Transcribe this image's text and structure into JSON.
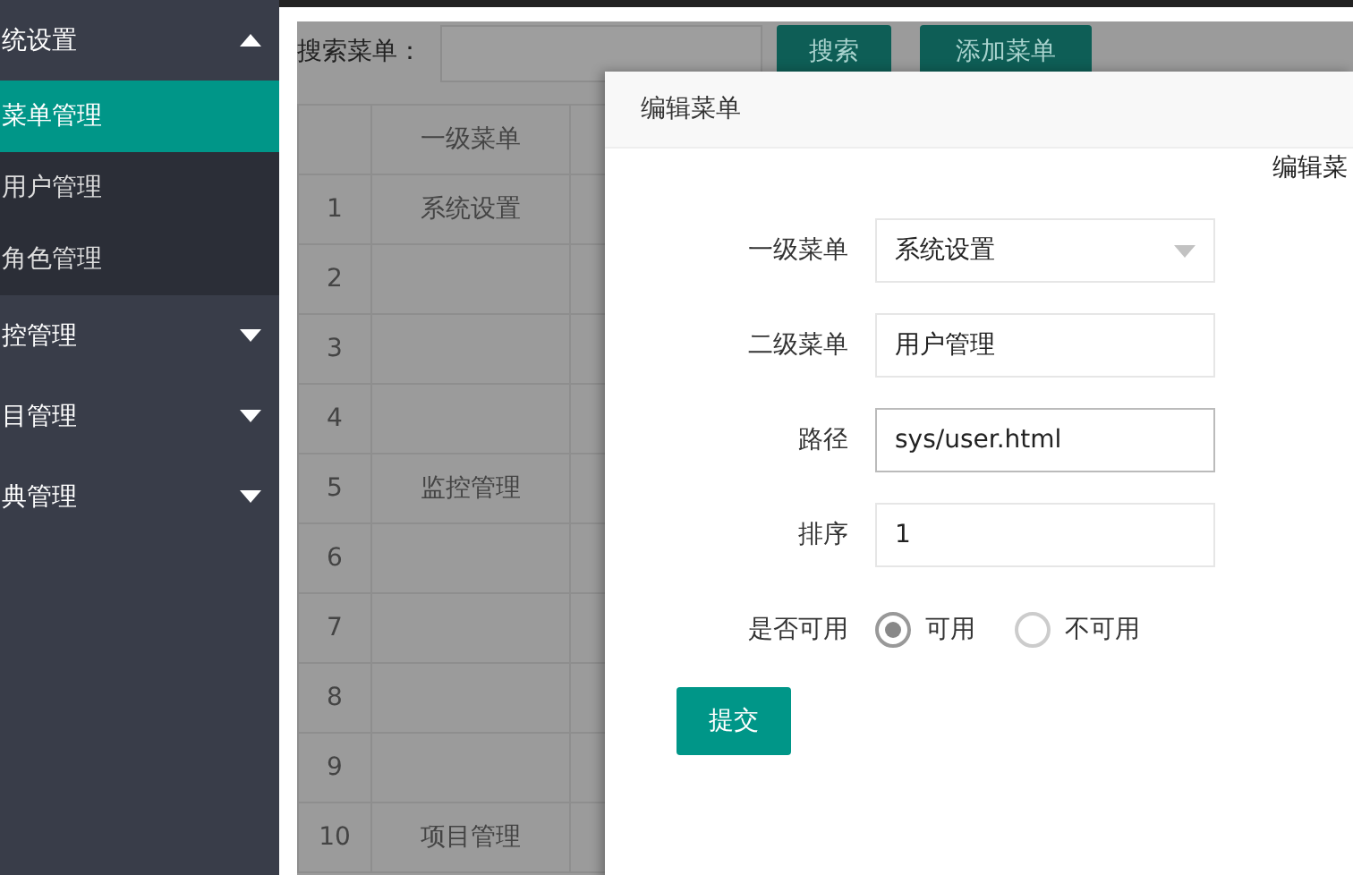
{
  "sidebar": {
    "groups": [
      {
        "label": "统设置",
        "expanded": true,
        "children": [
          {
            "label": "菜单管理",
            "selected": true
          },
          {
            "label": "用户管理",
            "selected": false
          },
          {
            "label": "角色管理",
            "selected": false
          }
        ]
      },
      {
        "label": "控管理",
        "expanded": false
      },
      {
        "label": "目管理",
        "expanded": false
      },
      {
        "label": "典管理",
        "expanded": false
      }
    ]
  },
  "toolbar": {
    "search_label": "搜索菜单：",
    "buttons": [
      "搜索",
      "添加菜单"
    ]
  },
  "table": {
    "columns": [
      "",
      "一级菜单"
    ],
    "rows": [
      [
        "1",
        "系统设置"
      ],
      [
        "2",
        ""
      ],
      [
        "3",
        ""
      ],
      [
        "4",
        ""
      ],
      [
        "5",
        "监控管理"
      ],
      [
        "6",
        ""
      ],
      [
        "7",
        ""
      ],
      [
        "8",
        ""
      ],
      [
        "9",
        ""
      ],
      [
        "10",
        "项目管理"
      ]
    ]
  },
  "dialog": {
    "title": "编辑菜单",
    "heading": "编辑菜",
    "fields": [
      {
        "kind": "select",
        "label": "一级菜单",
        "value": "系统设置",
        "focused": false
      },
      {
        "kind": "text",
        "label": "二级菜单",
        "value": "用户管理",
        "focused": false
      },
      {
        "kind": "text",
        "label": "路径",
        "value": "sys/user.html",
        "focused": true
      },
      {
        "kind": "text",
        "label": "排序",
        "value": "1",
        "focused": false
      },
      {
        "kind": "radio",
        "label": "是否可用",
        "options": [
          {
            "label": "可用",
            "selected": true
          },
          {
            "label": "不可用",
            "selected": false
          }
        ]
      }
    ],
    "submit": "提交"
  }
}
